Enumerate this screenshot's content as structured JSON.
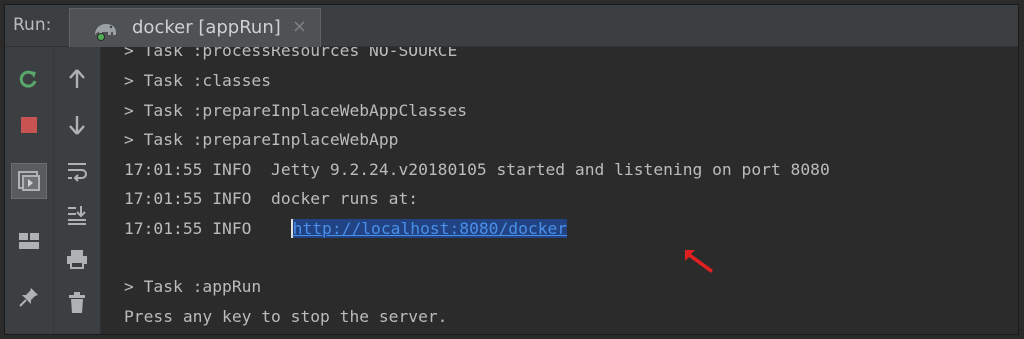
{
  "run_panel": {
    "label": "Run:",
    "tab": {
      "title": "docker [appRun]",
      "close": "×"
    }
  },
  "toolbar": {
    "left_column": [
      "rerun-icon",
      "stop-icon",
      "restore-layout-icon",
      "layout-icon",
      "pin-icon"
    ],
    "right_column": [
      "up-arrow-icon",
      "down-arrow-icon",
      "soft-wrap-icon",
      "scroll-to-end-icon",
      "print-icon",
      "trash-icon"
    ]
  },
  "console": {
    "lines": [
      "> Task :processResources NO-SOURCE",
      "> Task :classes",
      "> Task :prepareInplaceWebAppClasses",
      "> Task :prepareInplaceWebApp",
      "17:01:55 INFO  Jetty 9.2.24.v20180105 started and listening on port 8080",
      "17:01:55 INFO  docker runs at:",
      "17:01:55 INFO    ",
      "",
      "> Task :appRun",
      "Press any key to stop the server."
    ],
    "url": "http://localhost:8080/docker"
  },
  "colors": {
    "background": "#2b2b2b",
    "toolbar": "#3c3f41",
    "text": "#bbbbbb",
    "link": "#4a90e8",
    "selection": "#214283",
    "annotation_arrow": "#e02020"
  }
}
